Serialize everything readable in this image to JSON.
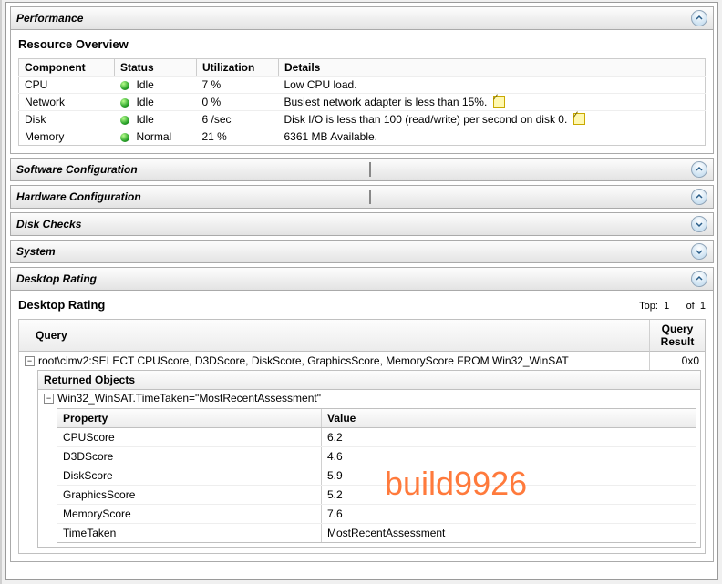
{
  "sections": {
    "performance": "Performance",
    "resource_overview_title": "Resource Overview",
    "software_config": "Software Configuration",
    "hardware_config": "Hardware Configuration",
    "disk_checks": "Disk Checks",
    "system": "System",
    "desktop_rating": "Desktop Rating"
  },
  "resource_table": {
    "headers": {
      "component": "Component",
      "status": "Status",
      "utilization": "Utilization",
      "details": "Details"
    },
    "rows": [
      {
        "component": "CPU",
        "status": "Idle",
        "utilization": "7 %",
        "details": "Low CPU load.",
        "has_note": false
      },
      {
        "component": "Network",
        "status": "Idle",
        "utilization": "0 %",
        "details": "Busiest network adapter is less than 15%.",
        "has_note": true
      },
      {
        "component": "Disk",
        "status": "Idle",
        "utilization": "6 /sec",
        "details": "Disk I/O is less than 100 (read/write) per second on disk 0.",
        "has_note": true
      },
      {
        "component": "Memory",
        "status": "Normal",
        "utilization": "21 %",
        "details": "6361 MB Available.",
        "has_note": false
      }
    ]
  },
  "desktop_rating_panel": {
    "title": "Desktop Rating",
    "top_label": "Top:",
    "top_value": "1",
    "of_label": "of",
    "of_value": "1"
  },
  "query_grid": {
    "headers": {
      "query": "Query",
      "result": "Query Result"
    },
    "query_text": "root\\cimv2:SELECT CPUScore, D3DScore, DiskScore, GraphicsScore, MemoryScore FROM Win32_WinSAT",
    "result_text": "0x0",
    "returned_objects_label": "Returned Objects",
    "object_path": "Win32_WinSAT.TimeTaken=\"MostRecentAssessment\"",
    "pv_headers": {
      "property": "Property",
      "value": "Value"
    },
    "properties": [
      {
        "property": "CPUScore",
        "value": "6.2"
      },
      {
        "property": "D3DScore",
        "value": "4.6"
      },
      {
        "property": "DiskScore",
        "value": "5.9"
      },
      {
        "property": "GraphicsScore",
        "value": "5.2"
      },
      {
        "property": "MemoryScore",
        "value": "7.6"
      },
      {
        "property": "TimeTaken",
        "value": "MostRecentAssessment"
      }
    ]
  },
  "watermark": "build9926"
}
